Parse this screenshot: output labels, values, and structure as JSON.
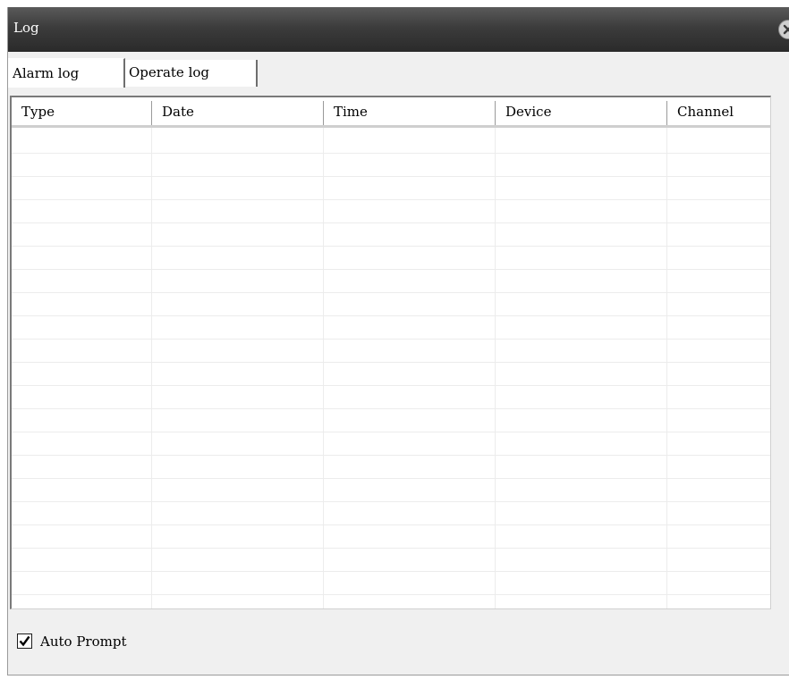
{
  "window": {
    "title": "Log",
    "close_icon": "close-icon"
  },
  "tabs": [
    {
      "label": "Alarm log",
      "active": true
    },
    {
      "label": "Operate log",
      "active": false
    }
  ],
  "table": {
    "columns": [
      "Type",
      "Date",
      "Time",
      "Device",
      "Channel"
    ],
    "rows": []
  },
  "footer": {
    "auto_prompt_label": "Auto Prompt",
    "auto_prompt_checked": true
  }
}
